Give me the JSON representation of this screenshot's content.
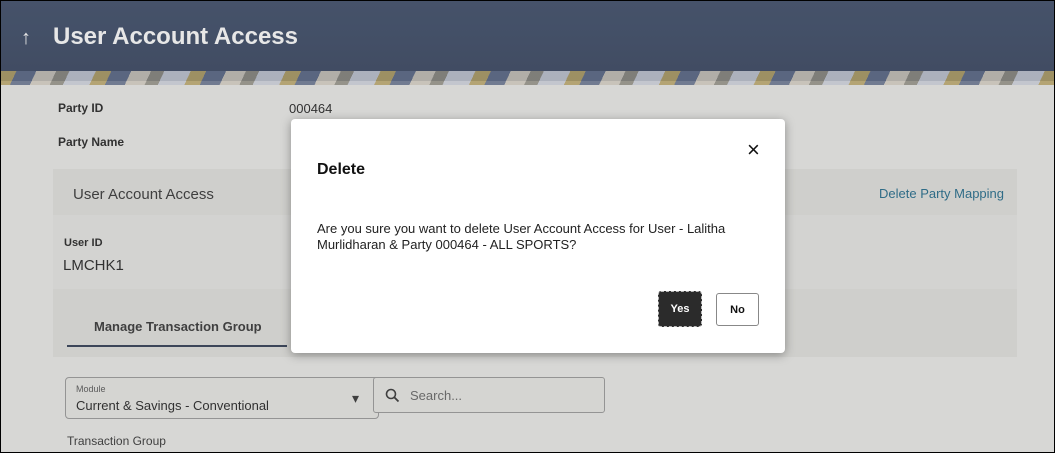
{
  "header": {
    "back_icon": "↑",
    "title": "User Account Access"
  },
  "party": {
    "id_label": "Party ID",
    "id_value": "000464",
    "name_label": "Party Name"
  },
  "section": {
    "title": "User Account Access",
    "delete_link": "Delete Party Mapping"
  },
  "user": {
    "id_label": "User ID",
    "id_value": "LMCHK1"
  },
  "tabs": {
    "manage_label": "Manage Transaction Group"
  },
  "filters": {
    "module_label": "Module",
    "module_value": "Current & Savings - Conventional",
    "dropdown_icon": "▾",
    "search_icon": "search-icon",
    "search_placeholder": "Search..."
  },
  "transaction_group_label": "Transaction Group",
  "dialog": {
    "title": "Delete",
    "close_icon": "×",
    "message": "Are you sure you want to delete User Account Access for User - Lalitha Murlidharan & Party 000464 - ALL SPORTS?",
    "yes_label": "Yes",
    "no_label": "No"
  }
}
